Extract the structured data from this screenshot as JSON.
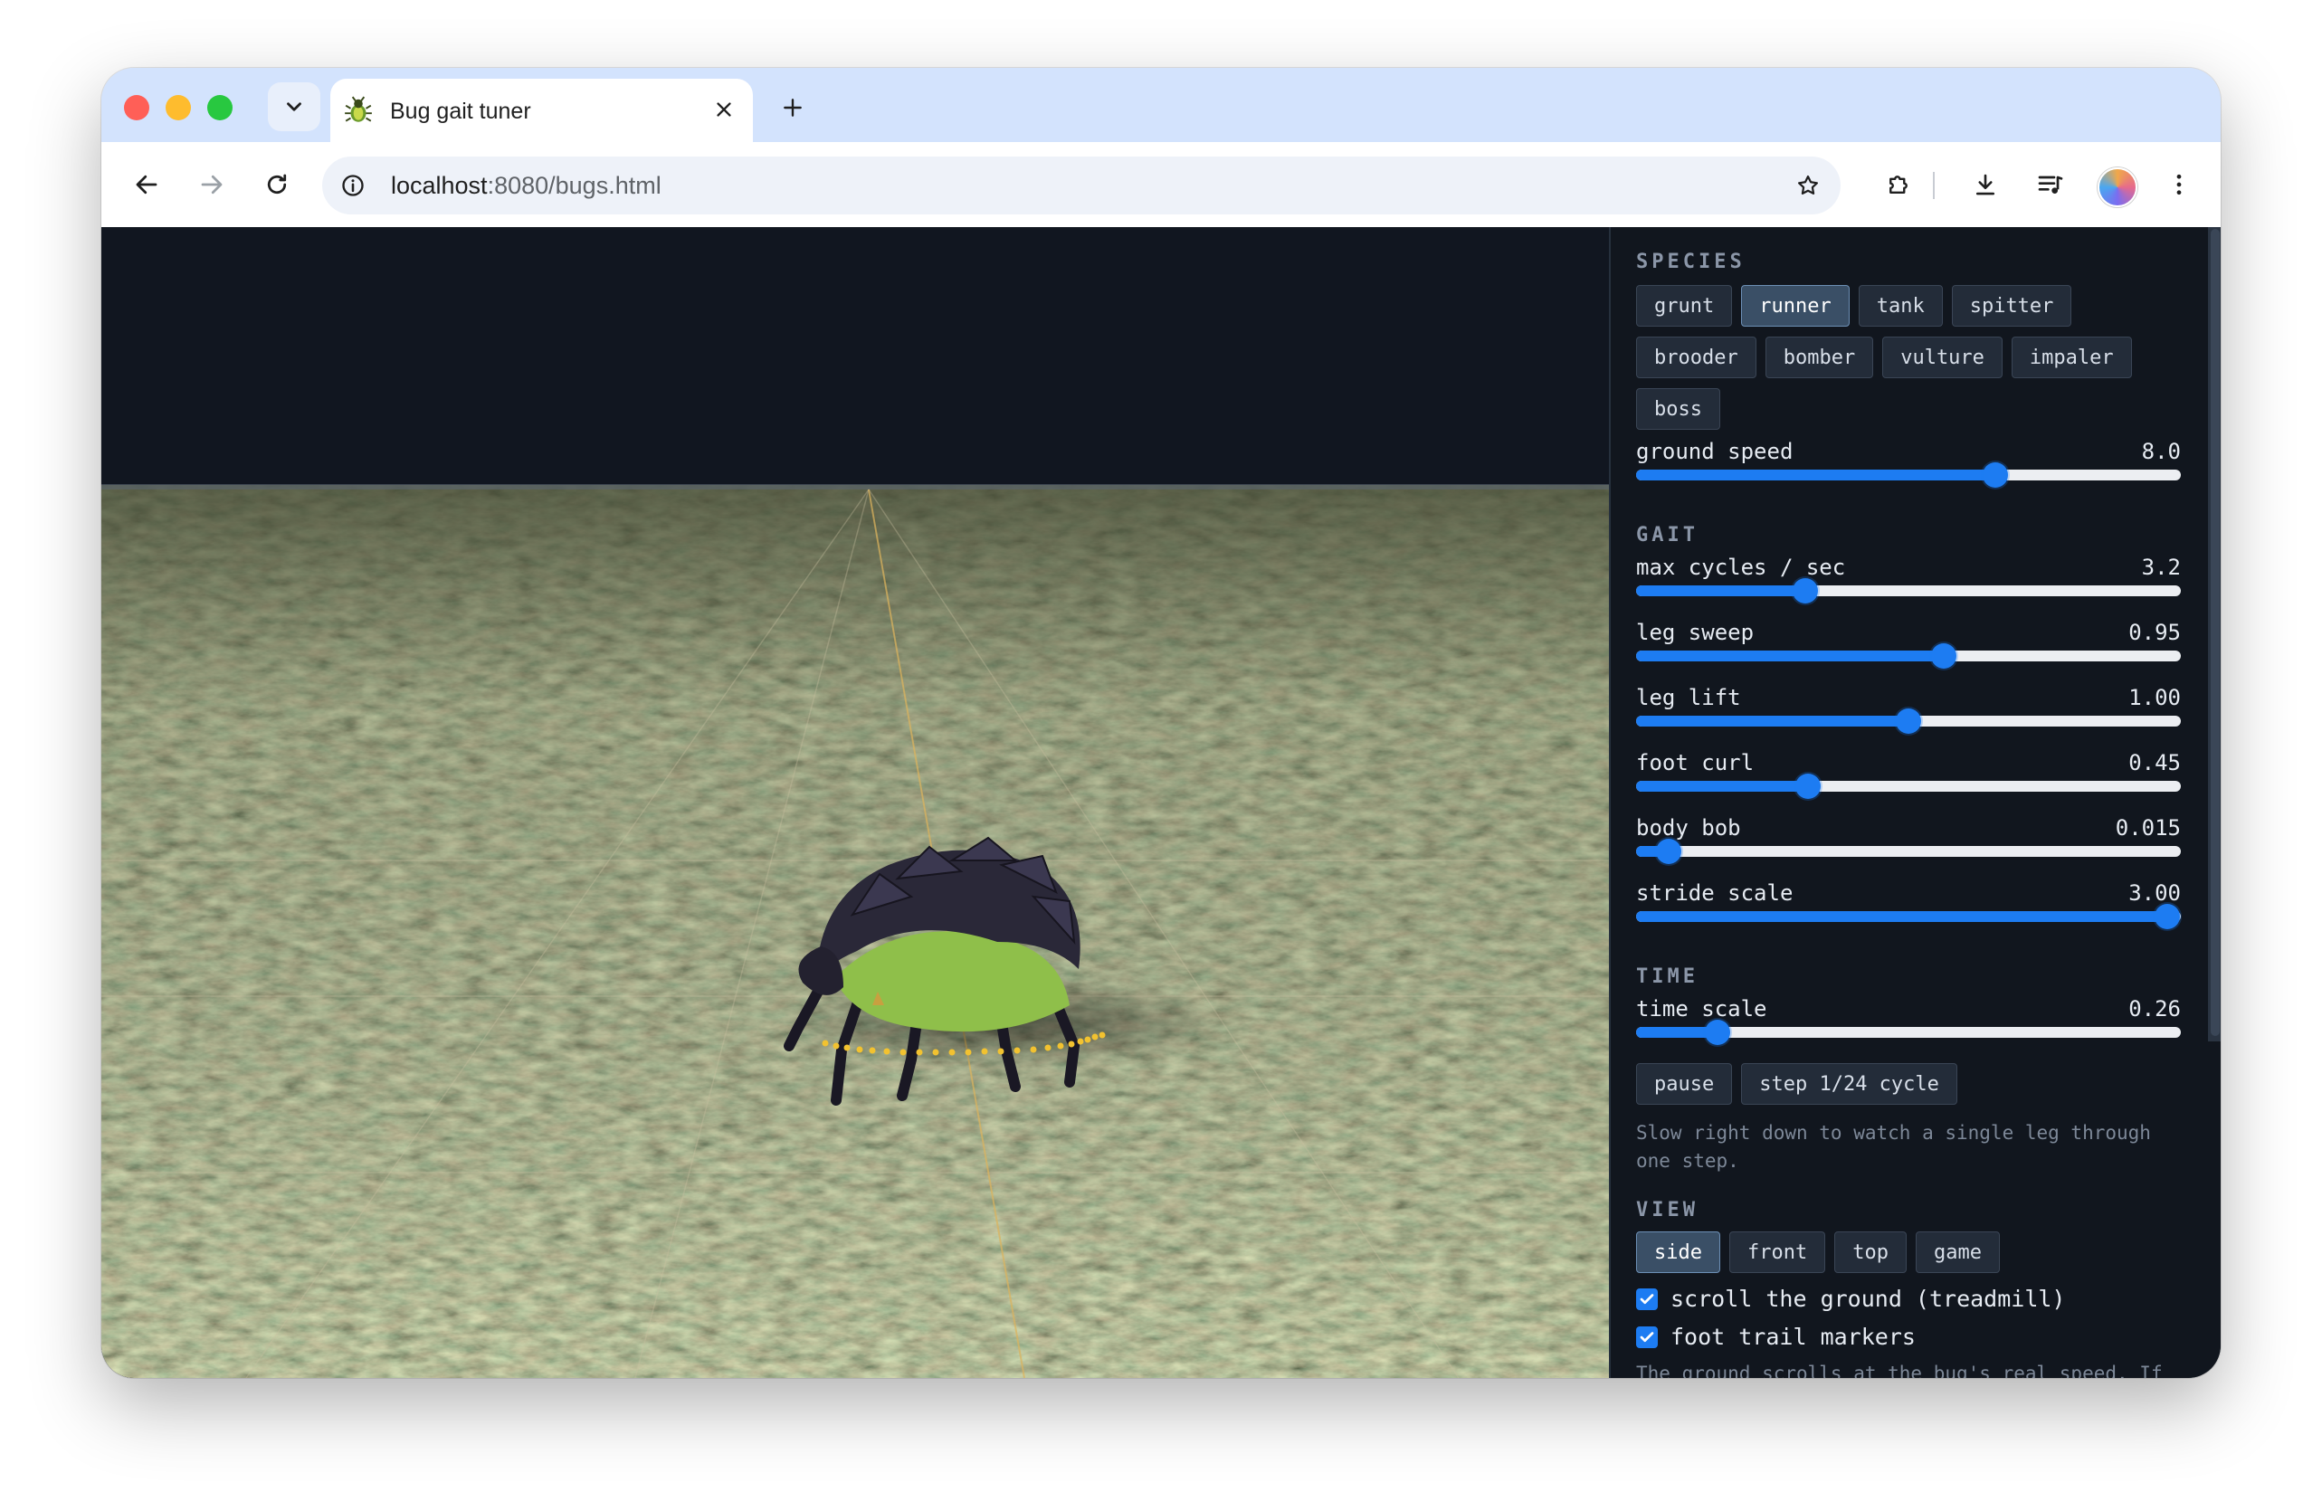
{
  "browser": {
    "tab_title": "Bug gait tuner",
    "url_host": "localhost",
    "url_rest": ":8080/bugs.html"
  },
  "panel": {
    "species": {
      "title": "SPECIES",
      "buttons": [
        "grunt",
        "runner",
        "tank",
        "spitter",
        "brooder",
        "bomber",
        "vulture",
        "impaler",
        "boss"
      ],
      "selected": "runner"
    },
    "ground_speed": {
      "label": "ground speed",
      "value": "8.0",
      "fraction": 0.66
    },
    "gait": {
      "title": "GAIT",
      "sliders": [
        {
          "label": "max cycles / sec",
          "value": "3.2",
          "fraction": 0.31
        },
        {
          "label": "leg sweep",
          "value": "0.95",
          "fraction": 0.565
        },
        {
          "label": "leg lift",
          "value": "1.00",
          "fraction": 0.5
        },
        {
          "label": "foot curl",
          "value": "0.45",
          "fraction": 0.315
        },
        {
          "label": "body bob",
          "value": "0.015",
          "fraction": 0.06
        },
        {
          "label": "stride scale",
          "value": "3.00",
          "fraction": 0.975
        }
      ]
    },
    "time": {
      "title": "TIME",
      "slider": {
        "label": "time scale",
        "value": "0.26",
        "fraction": 0.15
      },
      "pause_label": "pause",
      "step_label": "step 1/24 cycle",
      "hint": "Slow right down to watch a single leg through one step."
    },
    "view": {
      "title": "VIEW",
      "buttons": [
        "side",
        "front",
        "top",
        "game"
      ],
      "selected": "side",
      "checks": [
        {
          "label": "scroll the ground (treadmill)",
          "checked": true
        },
        {
          "label": "foot trail markers",
          "checked": true
        }
      ],
      "hint": "The ground scrolls at the bug's real speed. If"
    }
  },
  "colors": {
    "accent": "#1d7cf2",
    "trail": "#f2c230",
    "bug_body": "#2a2838",
    "bug_belly": "#8fbf4a"
  }
}
